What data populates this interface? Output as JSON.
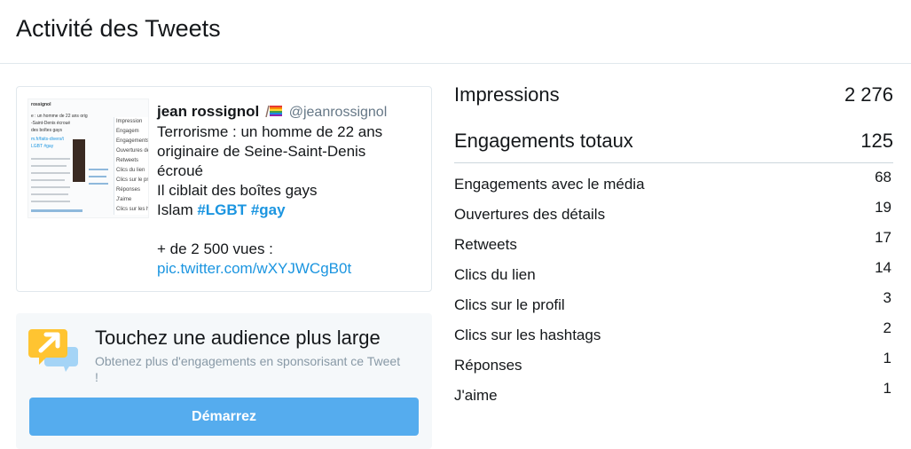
{
  "page": {
    "title": "Activité des Tweets"
  },
  "tweet": {
    "author_name": "jean rossignol",
    "author_emoji": "rainbow-flag-icon",
    "author_handle": "@jeanrossignol",
    "lines": [
      "Terrorisme : un homme de 22 ans",
      "originaire de Seine-Saint-Denis",
      "écroué",
      "Il ciblait des boîtes gays"
    ],
    "line5_prefix": "Islam ",
    "hashtag1": "#LGBT",
    "hashtag2": "#gay",
    "line6": "+ de 2 500 vues :",
    "link": "pic.twitter.com/wXYJWCgB0t",
    "thumbnail": {
      "snippets": [
        "rossignol",
        "e : un homme de 22 ans orig",
        "-Saint-Denis écroué",
        "des boîtes gays",
        "m.fr/faits-divers/t",
        "LGBT #gay"
      ],
      "panel_items": [
        "Impression",
        "Engagem",
        "Engagements",
        "Ouvertures des",
        "Retweets",
        "Clics du lien",
        "Clics sur le pr",
        "Réponses",
        "J'aime",
        "Clics sur les h"
      ]
    }
  },
  "promo": {
    "title": "Touchez une audience plus large",
    "text": "Obtenez plus d'engagements en sponsorisant ce Tweet !",
    "button_label": "Démarrez",
    "icon": "promote-chat-arrow-icon"
  },
  "stats": {
    "impressions": {
      "label": "Impressions",
      "value": "2 276"
    },
    "engagements": {
      "label": "Engagements totaux",
      "value": "125"
    },
    "rows": [
      {
        "label": "Engagements avec le média",
        "value": "68"
      },
      {
        "label": "Ouvertures des détails",
        "value": "19"
      },
      {
        "label": "Retweets",
        "value": "17"
      },
      {
        "label": "Clics du lien",
        "value": "14"
      },
      {
        "label": "Clics sur le profil",
        "value": "3"
      },
      {
        "label": "Clics sur les hashtags",
        "value": "2"
      },
      {
        "label": "Réponses",
        "value": "1"
      },
      {
        "label": "J'aime",
        "value": "1"
      }
    ]
  },
  "colors": {
    "link": "#1b95e0",
    "button": "#55acee",
    "promo_bg": "#f5f8fa",
    "muted": "#657786"
  }
}
